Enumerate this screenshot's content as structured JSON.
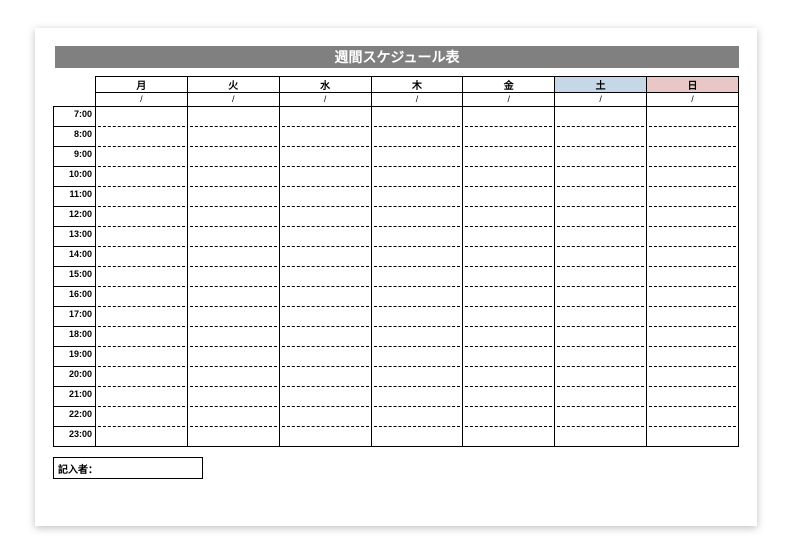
{
  "title": "週間スケジュール表",
  "days": [
    "月",
    "火",
    "水",
    "木",
    "金",
    "土",
    "日"
  ],
  "dates": [
    "/",
    "/",
    "/",
    "/",
    "/",
    "/",
    "/"
  ],
  "times": [
    "7:00",
    "8:00",
    "9:00",
    "10:00",
    "11:00",
    "12:00",
    "13:00",
    "14:00",
    "15:00",
    "16:00",
    "17:00",
    "18:00",
    "19:00",
    "20:00",
    "21:00",
    "22:00",
    "23:00"
  ],
  "author_label": "記入者：",
  "colors": {
    "title_bg": "#808080",
    "sat_bg": "#c6d7e8",
    "sun_bg": "#e9c7c7"
  },
  "chart_data": {
    "type": "table",
    "title": "週間スケジュール表",
    "columns": [
      "月",
      "火",
      "水",
      "木",
      "金",
      "土",
      "日"
    ],
    "rows": [
      "7:00",
      "8:00",
      "9:00",
      "10:00",
      "11:00",
      "12:00",
      "13:00",
      "14:00",
      "15:00",
      "16:00",
      "17:00",
      "18:00",
      "19:00",
      "20:00",
      "21:00",
      "22:00",
      "23:00"
    ],
    "values": []
  }
}
